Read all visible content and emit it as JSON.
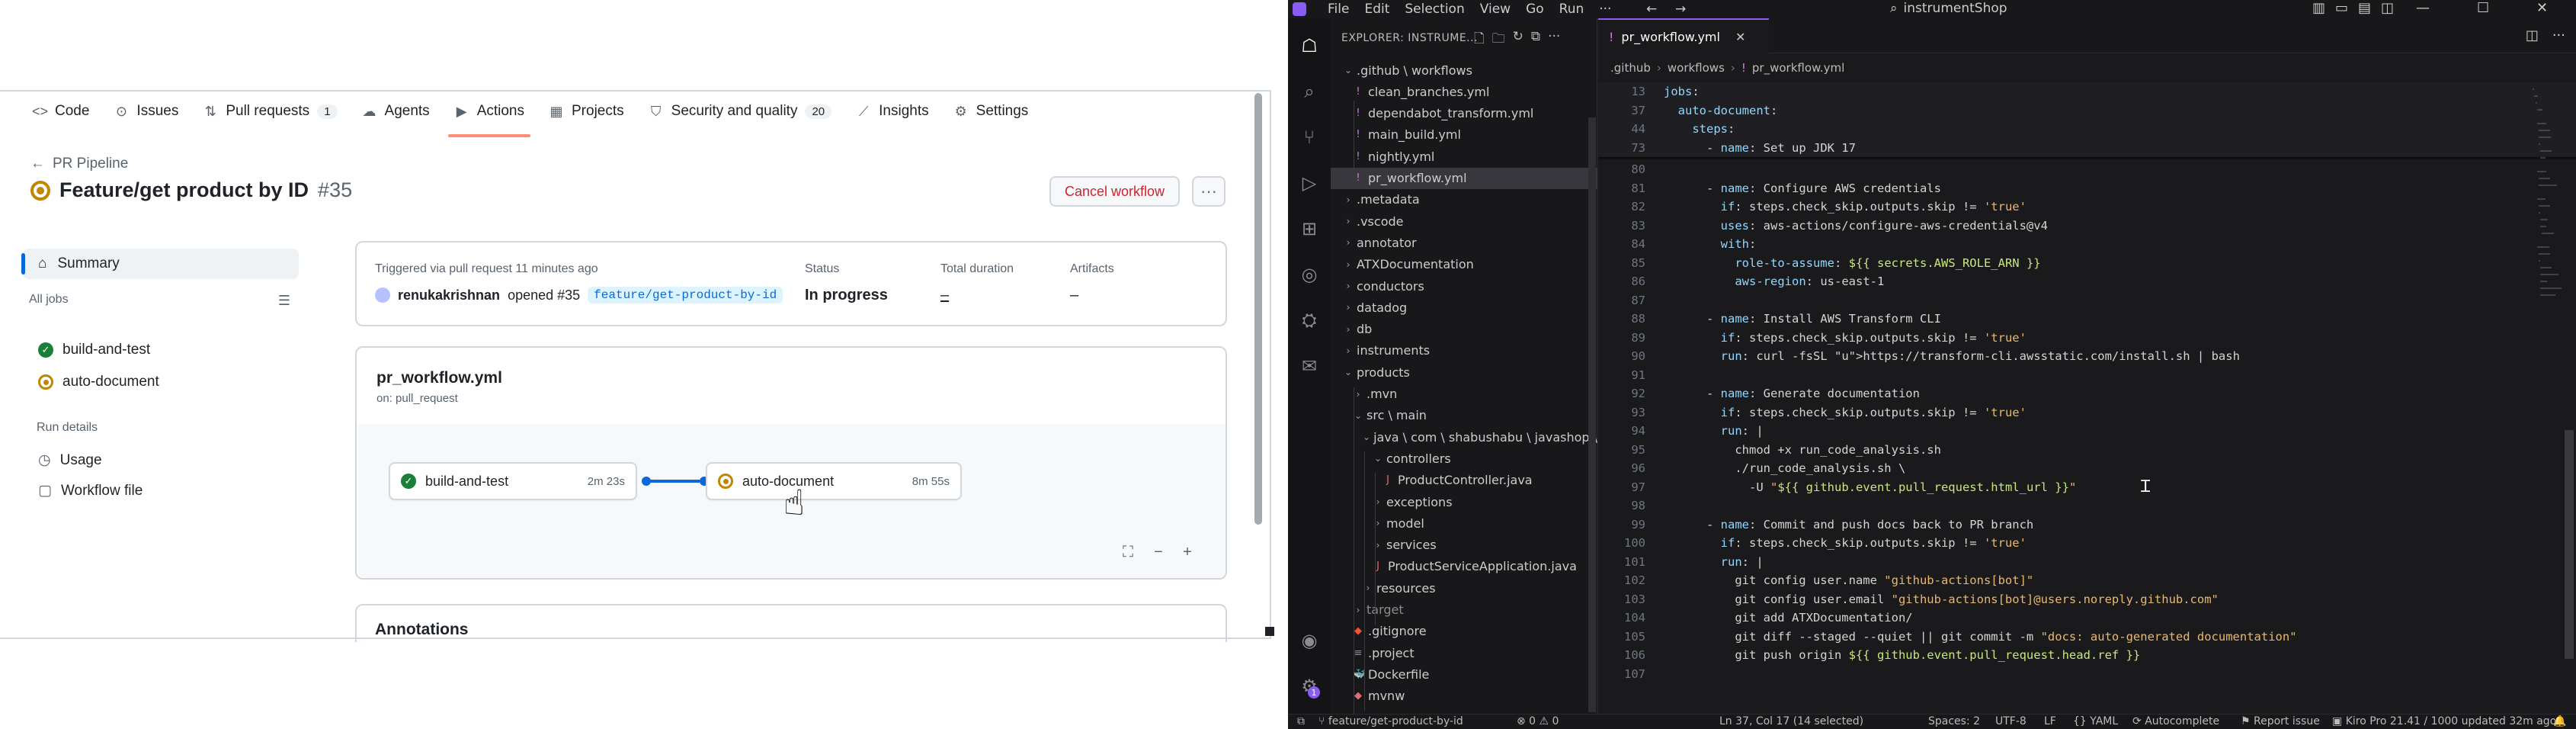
{
  "github": {
    "repo_tabs": [
      {
        "label": "Code",
        "icon": "code-icon"
      },
      {
        "label": "Issues",
        "icon": "issue-icon"
      },
      {
        "label": "Pull requests",
        "icon": "pull-request-icon",
        "count": "1"
      },
      {
        "label": "Agents",
        "icon": "agents-icon"
      },
      {
        "label": "Actions",
        "icon": "play-icon",
        "active": true
      },
      {
        "label": "Projects",
        "icon": "table-icon"
      },
      {
        "label": "Security and quality",
        "icon": "shield-icon",
        "count": "20"
      },
      {
        "label": "Insights",
        "icon": "graph-icon"
      },
      {
        "label": "Settings",
        "icon": "gear-icon"
      }
    ],
    "back_link": "PR Pipeline",
    "run_title": "Feature/get product by ID",
    "run_number": "#35",
    "cancel_label": "Cancel workflow",
    "more_label": "···",
    "sidebar": {
      "summary_label": "Summary",
      "all_jobs_label": "All jobs",
      "jobs": [
        {
          "label": "build-and-test",
          "status": "success"
        },
        {
          "label": "auto-document",
          "status": "in_progress"
        }
      ],
      "run_details_label": "Run details",
      "details": [
        {
          "label": "Usage",
          "icon": "clock-icon"
        },
        {
          "label": "Workflow file",
          "icon": "file-icon"
        }
      ]
    },
    "summary": {
      "trigger_text": "Triggered via pull request 11 minutes ago",
      "actor": "renukakrishnan",
      "action_text": "opened #35",
      "branch": "feature/get-product-by-id",
      "status_label": "Status",
      "status_value": "In progress",
      "duration_label": "Total duration",
      "duration_value": "–",
      "artifacts_label": "Artifacts",
      "artifacts_value": "–"
    },
    "workflow": {
      "name": "pr_workflow.yml",
      "trigger": "on: pull_request",
      "jobs": [
        {
          "label": "build-and-test",
          "duration": "2m 23s",
          "status": "success"
        },
        {
          "label": "auto-document",
          "duration": "8m 55s",
          "status": "in_progress"
        }
      ]
    },
    "annotations_label": "Annotations",
    "colors": {
      "success": "#1a7f37",
      "in_progress": "#bf8700",
      "danger": "#cf222e",
      "accent": "#0969da",
      "active_tab": "#fd8c73"
    }
  },
  "ide": {
    "menu": [
      "File",
      "Edit",
      "Selection",
      "View",
      "Go",
      "Run",
      "···"
    ],
    "search_text": "instrumentShop",
    "explorer_title": "EXPLORER: INSTRUME...",
    "tree": [
      {
        "label": ".github \\ workflows",
        "type": "folder-open",
        "depth": 0
      },
      {
        "label": "clean_branches.yml",
        "type": "yml",
        "depth": 1
      },
      {
        "label": "dependabot_transform.yml",
        "type": "yml",
        "depth": 1
      },
      {
        "label": "main_build.yml",
        "type": "yml",
        "depth": 1
      },
      {
        "label": "nightly.yml",
        "type": "yml",
        "depth": 1
      },
      {
        "label": "pr_workflow.yml",
        "type": "yml",
        "depth": 1,
        "selected": true
      },
      {
        "label": ".metadata",
        "type": "folder",
        "depth": 0
      },
      {
        "label": ".vscode",
        "type": "folder",
        "depth": 0
      },
      {
        "label": "annotator",
        "type": "folder",
        "depth": 0
      },
      {
        "label": "ATXDocumentation",
        "type": "folder",
        "depth": 0
      },
      {
        "label": "conductors",
        "type": "folder",
        "depth": 0
      },
      {
        "label": "datadog",
        "type": "folder",
        "depth": 0
      },
      {
        "label": "db",
        "type": "folder",
        "depth": 0
      },
      {
        "label": "instruments",
        "type": "folder",
        "depth": 0
      },
      {
        "label": "products",
        "type": "folder-open",
        "depth": 0
      },
      {
        "label": ".mvn",
        "type": "folder",
        "depth": 1
      },
      {
        "label": "src \\ main",
        "type": "folder-open",
        "depth": 1
      },
      {
        "label": "java \\ com \\ shabushabu \\ javashop \\ p...",
        "type": "folder-open",
        "depth": 2
      },
      {
        "label": "controllers",
        "type": "folder-open",
        "depth": 3
      },
      {
        "label": "ProductController.java",
        "type": "java",
        "depth": 4
      },
      {
        "label": "exceptions",
        "type": "folder",
        "depth": 3
      },
      {
        "label": "model",
        "type": "folder",
        "depth": 3
      },
      {
        "label": "services",
        "type": "folder",
        "depth": 3
      },
      {
        "label": "ProductServiceApplication.java",
        "type": "java",
        "depth": 3
      },
      {
        "label": "resources",
        "type": "folder",
        "depth": 2
      },
      {
        "label": "target",
        "type": "folder",
        "depth": 1,
        "dim": true
      },
      {
        "label": ".gitignore",
        "type": "git",
        "depth": 1
      },
      {
        "label": ".project",
        "type": "file",
        "depth": 1
      },
      {
        "label": "Dockerfile",
        "type": "docker",
        "depth": 1
      },
      {
        "label": "mvnw",
        "type": "file-red",
        "depth": 1
      }
    ],
    "editor_tab": "pr_workflow.yml",
    "breadcrumb": [
      ".github",
      "workflows",
      "pr_workflow.yml"
    ],
    "sticky_lines": [
      {
        "n": "13",
        "text": "jobs:"
      },
      {
        "n": "37",
        "text": "  auto-document:"
      },
      {
        "n": "44",
        "text": "    steps:"
      },
      {
        "n": "73",
        "text": "      - name: Set up JDK 17"
      }
    ],
    "code_lines": [
      {
        "n": "80",
        "text": ""
      },
      {
        "n": "81",
        "text": "      - name: Configure AWS credentials"
      },
      {
        "n": "82",
        "text": "        if: steps.check_skip.outputs.skip != 'true'"
      },
      {
        "n": "83",
        "text": "        uses: aws-actions/configure-aws-credentials@v4"
      },
      {
        "n": "84",
        "text": "        with:"
      },
      {
        "n": "85",
        "text": "          role-to-assume: ${{ secrets.AWS_ROLE_ARN }}"
      },
      {
        "n": "86",
        "text": "          aws-region: us-east-1"
      },
      {
        "n": "87",
        "text": ""
      },
      {
        "n": "88",
        "text": "      - name: Install AWS Transform CLI"
      },
      {
        "n": "89",
        "text": "        if: steps.check_skip.outputs.skip != 'true'"
      },
      {
        "n": "90",
        "text": "        run: curl -fsSL https://transform-cli.awsstatic.com/install.sh | bash"
      },
      {
        "n": "91",
        "text": ""
      },
      {
        "n": "92",
        "text": "      - name: Generate documentation"
      },
      {
        "n": "93",
        "text": "        if: steps.check_skip.outputs.skip != 'true'"
      },
      {
        "n": "94",
        "text": "        run: |"
      },
      {
        "n": "95",
        "text": "          chmod +x run_code_analysis.sh"
      },
      {
        "n": "96",
        "text": "          ./run_code_analysis.sh \\"
      },
      {
        "n": "97",
        "text": "            -U \"${{ github.event.pull_request.html_url }}\""
      },
      {
        "n": "98",
        "text": ""
      },
      {
        "n": "99",
        "text": "      - name: Commit and push docs back to PR branch"
      },
      {
        "n": "100",
        "text": "        if: steps.check_skip.outputs.skip != 'true'"
      },
      {
        "n": "101",
        "text": "        run: |"
      },
      {
        "n": "102",
        "text": "          git config user.name \"github-actions[bot]\""
      },
      {
        "n": "103",
        "text": "          git config user.email \"github-actions[bot]@users.noreply.github.com\""
      },
      {
        "n": "104",
        "text": "          git add ATXDocumentation/"
      },
      {
        "n": "105",
        "text": "          git diff --staged --quiet || git commit -m \"docs: auto-generated documentation\""
      },
      {
        "n": "106",
        "text": "          git push origin ${{ github.event.pull_request.head.ref }}"
      },
      {
        "n": "107",
        "text": ""
      }
    ],
    "status": {
      "branch": "feature/get-product-by-id",
      "problems": "⊗ 0 ⚠ 0",
      "cursor": "Ln 37, Col 17 (14 selected)",
      "spaces": "Spaces: 2",
      "encoding": "UTF-8",
      "eol": "LF",
      "language": "{} YAML",
      "autocomplete": "Autocomplete",
      "report": "Report issue",
      "plan": "Kiro Pro 21.41 / 1000 updated 32m ago"
    },
    "colors": {
      "accent": "#8a5cf6",
      "key": "#8fd7ff",
      "string": "#e8b86d",
      "value": "#c8e77a"
    }
  }
}
